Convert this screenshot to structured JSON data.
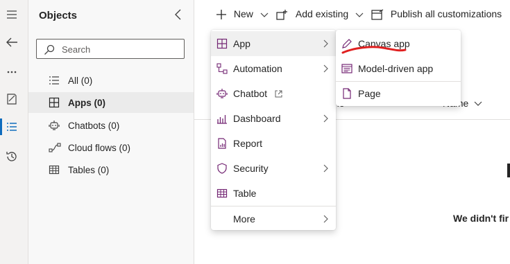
{
  "objects_panel": {
    "title": "Objects",
    "search_placeholder": "Search",
    "items": [
      {
        "label": "All (0)",
        "icon": "list-icon"
      },
      {
        "label": "Apps (0)",
        "icon": "apps-icon"
      },
      {
        "label": "Chatbots (0)",
        "icon": "chatbot-icon"
      },
      {
        "label": "Cloud flows (0)",
        "icon": "flow-icon"
      },
      {
        "label": "Tables (0)",
        "icon": "table-icon"
      }
    ]
  },
  "toolbar": {
    "new_label": "New",
    "add_existing_label": "Add existing",
    "publish_label": "Publish all customizations"
  },
  "main": {
    "col_header_left": "ne",
    "col_header_right": "Name",
    "empty_message": "We didn't fir"
  },
  "new_menu": {
    "items": [
      {
        "label": "App",
        "icon": "app-icon",
        "has_submenu": true
      },
      {
        "label": "Automation",
        "icon": "automation-icon",
        "has_submenu": true
      },
      {
        "label": "Chatbot",
        "icon": "chatbot-icon",
        "has_submenu": false
      },
      {
        "label": "Dashboard",
        "icon": "dashboard-icon",
        "has_submenu": true
      },
      {
        "label": "Report",
        "icon": "report-icon",
        "has_submenu": false
      },
      {
        "label": "Security",
        "icon": "shield-icon",
        "has_submenu": true
      },
      {
        "label": "Table",
        "icon": "table-icon",
        "has_submenu": false
      },
      {
        "label": "More",
        "icon": "",
        "has_submenu": true
      }
    ]
  },
  "app_submenu": {
    "items": [
      {
        "label": "Canvas app",
        "icon": "pen-icon"
      },
      {
        "label": "Model-driven app",
        "icon": "model-driven-icon"
      },
      {
        "label": "Page",
        "icon": "page-icon"
      }
    ]
  },
  "colors": {
    "accent_purple": "#742774",
    "annotation_red": "#e02020",
    "selected_bg": "#ebebeb",
    "rail_selected": "#0f6cbd"
  }
}
